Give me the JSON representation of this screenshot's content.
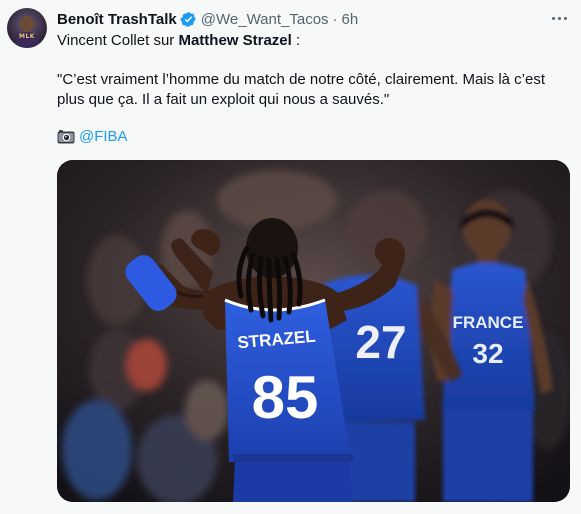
{
  "tweet": {
    "author_name": "Benoît TrashTalk",
    "handle": "@We_Want_Tacos",
    "separator": "·",
    "time": "6h",
    "intro_prefix": "Vincent Collet sur ",
    "intro_bold": "Matthew Strazel",
    "intro_suffix": " :",
    "quote": "\"C’est vraiment l’homme du match de notre côté, clairement. Mais là c’est plus que ça. Il a fait un exploit qui nous a sauvés.\"",
    "credit_mention": "@FIBA",
    "avatar_text": "MLK"
  },
  "media": {
    "player_main_name": "STRAZEL",
    "player_main_number": "85",
    "player_mid_number": "27",
    "player_right_team": "FRANCE",
    "player_right_number": "32"
  },
  "colors": {
    "accent": "#1d9bf0",
    "jersey_blue": "#2450c8",
    "text_secondary": "#536471"
  },
  "icons": [
    "verified-badge-icon",
    "more-options-icon",
    "camera-icon"
  ]
}
